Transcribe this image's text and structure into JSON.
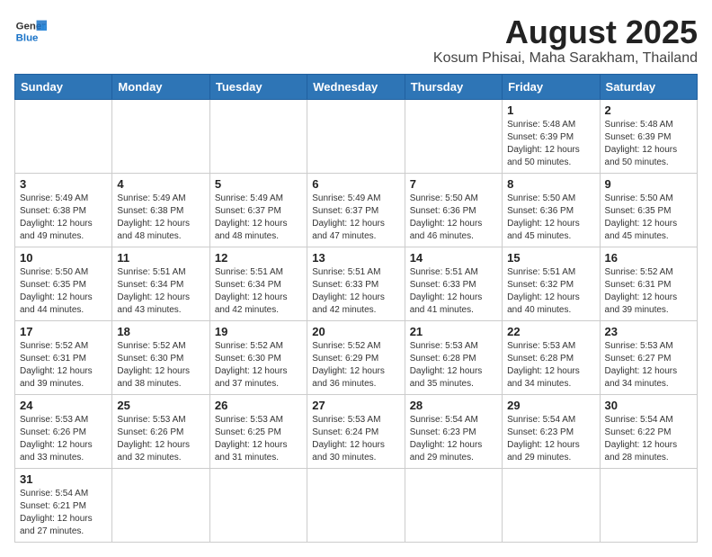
{
  "header": {
    "logo_general": "General",
    "logo_blue": "Blue",
    "month_year": "August 2025",
    "location": "Kosum Phisai, Maha Sarakham, Thailand"
  },
  "days_of_week": [
    "Sunday",
    "Monday",
    "Tuesday",
    "Wednesday",
    "Thursday",
    "Friday",
    "Saturday"
  ],
  "weeks": [
    [
      {
        "day": "",
        "info": ""
      },
      {
        "day": "",
        "info": ""
      },
      {
        "day": "",
        "info": ""
      },
      {
        "day": "",
        "info": ""
      },
      {
        "day": "",
        "info": ""
      },
      {
        "day": "1",
        "info": "Sunrise: 5:48 AM\nSunset: 6:39 PM\nDaylight: 12 hours\nand 50 minutes."
      },
      {
        "day": "2",
        "info": "Sunrise: 5:48 AM\nSunset: 6:39 PM\nDaylight: 12 hours\nand 50 minutes."
      }
    ],
    [
      {
        "day": "3",
        "info": "Sunrise: 5:49 AM\nSunset: 6:38 PM\nDaylight: 12 hours\nand 49 minutes."
      },
      {
        "day": "4",
        "info": "Sunrise: 5:49 AM\nSunset: 6:38 PM\nDaylight: 12 hours\nand 48 minutes."
      },
      {
        "day": "5",
        "info": "Sunrise: 5:49 AM\nSunset: 6:37 PM\nDaylight: 12 hours\nand 48 minutes."
      },
      {
        "day": "6",
        "info": "Sunrise: 5:49 AM\nSunset: 6:37 PM\nDaylight: 12 hours\nand 47 minutes."
      },
      {
        "day": "7",
        "info": "Sunrise: 5:50 AM\nSunset: 6:36 PM\nDaylight: 12 hours\nand 46 minutes."
      },
      {
        "day": "8",
        "info": "Sunrise: 5:50 AM\nSunset: 6:36 PM\nDaylight: 12 hours\nand 45 minutes."
      },
      {
        "day": "9",
        "info": "Sunrise: 5:50 AM\nSunset: 6:35 PM\nDaylight: 12 hours\nand 45 minutes."
      }
    ],
    [
      {
        "day": "10",
        "info": "Sunrise: 5:50 AM\nSunset: 6:35 PM\nDaylight: 12 hours\nand 44 minutes."
      },
      {
        "day": "11",
        "info": "Sunrise: 5:51 AM\nSunset: 6:34 PM\nDaylight: 12 hours\nand 43 minutes."
      },
      {
        "day": "12",
        "info": "Sunrise: 5:51 AM\nSunset: 6:34 PM\nDaylight: 12 hours\nand 42 minutes."
      },
      {
        "day": "13",
        "info": "Sunrise: 5:51 AM\nSunset: 6:33 PM\nDaylight: 12 hours\nand 42 minutes."
      },
      {
        "day": "14",
        "info": "Sunrise: 5:51 AM\nSunset: 6:33 PM\nDaylight: 12 hours\nand 41 minutes."
      },
      {
        "day": "15",
        "info": "Sunrise: 5:51 AM\nSunset: 6:32 PM\nDaylight: 12 hours\nand 40 minutes."
      },
      {
        "day": "16",
        "info": "Sunrise: 5:52 AM\nSunset: 6:31 PM\nDaylight: 12 hours\nand 39 minutes."
      }
    ],
    [
      {
        "day": "17",
        "info": "Sunrise: 5:52 AM\nSunset: 6:31 PM\nDaylight: 12 hours\nand 39 minutes."
      },
      {
        "day": "18",
        "info": "Sunrise: 5:52 AM\nSunset: 6:30 PM\nDaylight: 12 hours\nand 38 minutes."
      },
      {
        "day": "19",
        "info": "Sunrise: 5:52 AM\nSunset: 6:30 PM\nDaylight: 12 hours\nand 37 minutes."
      },
      {
        "day": "20",
        "info": "Sunrise: 5:52 AM\nSunset: 6:29 PM\nDaylight: 12 hours\nand 36 minutes."
      },
      {
        "day": "21",
        "info": "Sunrise: 5:53 AM\nSunset: 6:28 PM\nDaylight: 12 hours\nand 35 minutes."
      },
      {
        "day": "22",
        "info": "Sunrise: 5:53 AM\nSunset: 6:28 PM\nDaylight: 12 hours\nand 34 minutes."
      },
      {
        "day": "23",
        "info": "Sunrise: 5:53 AM\nSunset: 6:27 PM\nDaylight: 12 hours\nand 34 minutes."
      }
    ],
    [
      {
        "day": "24",
        "info": "Sunrise: 5:53 AM\nSunset: 6:26 PM\nDaylight: 12 hours\nand 33 minutes."
      },
      {
        "day": "25",
        "info": "Sunrise: 5:53 AM\nSunset: 6:26 PM\nDaylight: 12 hours\nand 32 minutes."
      },
      {
        "day": "26",
        "info": "Sunrise: 5:53 AM\nSunset: 6:25 PM\nDaylight: 12 hours\nand 31 minutes."
      },
      {
        "day": "27",
        "info": "Sunrise: 5:53 AM\nSunset: 6:24 PM\nDaylight: 12 hours\nand 30 minutes."
      },
      {
        "day": "28",
        "info": "Sunrise: 5:54 AM\nSunset: 6:23 PM\nDaylight: 12 hours\nand 29 minutes."
      },
      {
        "day": "29",
        "info": "Sunrise: 5:54 AM\nSunset: 6:23 PM\nDaylight: 12 hours\nand 29 minutes."
      },
      {
        "day": "30",
        "info": "Sunrise: 5:54 AM\nSunset: 6:22 PM\nDaylight: 12 hours\nand 28 minutes."
      }
    ],
    [
      {
        "day": "31",
        "info": "Sunrise: 5:54 AM\nSunset: 6:21 PM\nDaylight: 12 hours\nand 27 minutes."
      },
      {
        "day": "",
        "info": ""
      },
      {
        "day": "",
        "info": ""
      },
      {
        "day": "",
        "info": ""
      },
      {
        "day": "",
        "info": ""
      },
      {
        "day": "",
        "info": ""
      },
      {
        "day": "",
        "info": ""
      }
    ]
  ]
}
